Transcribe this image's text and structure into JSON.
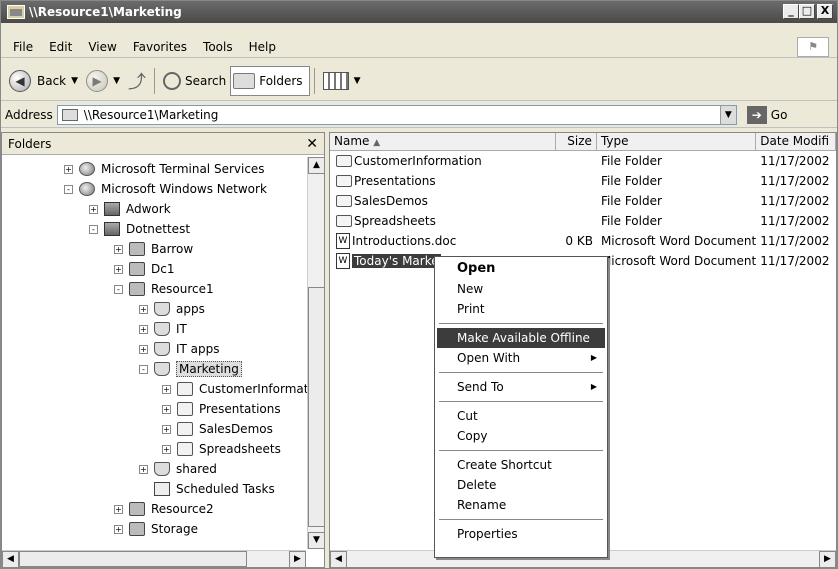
{
  "window": {
    "title": "\\\\Resource1\\Marketing",
    "minimize": "_",
    "maximize": "□",
    "close": "X"
  },
  "menu": [
    "File",
    "Edit",
    "View",
    "Favorites",
    "Tools",
    "Help"
  ],
  "toolbar": {
    "back_label": "Back",
    "search_label": "Search",
    "folders_label": "Folders"
  },
  "address": {
    "label": "Address",
    "value": "\\\\Resource1\\Marketing",
    "go_label": "Go"
  },
  "folders_pane": {
    "title": "Folders",
    "close": "✕"
  },
  "tree": [
    {
      "label": "Microsoft Terminal Services",
      "icon": "globe-icon",
      "expander": "+"
    },
    {
      "label": "Microsoft Windows Network",
      "icon": "globe-icon",
      "expander": "-"
    },
    {
      "label": "Adwork",
      "icon": "network-icon",
      "expander": "+"
    },
    {
      "label": "Dotnettest",
      "icon": "network-icon",
      "expander": "-"
    },
    {
      "label": "Barrow",
      "icon": "computer-icon",
      "expander": "+"
    },
    {
      "label": "Dc1",
      "icon": "computer-icon",
      "expander": "+"
    },
    {
      "label": "Resource1",
      "icon": "computer-icon",
      "expander": "-"
    },
    {
      "label": "apps",
      "icon": "share-icon",
      "expander": "+"
    },
    {
      "label": "IT",
      "icon": "share-icon",
      "expander": "+"
    },
    {
      "label": "IT apps",
      "icon": "share-icon",
      "expander": "+"
    },
    {
      "label": "Marketing",
      "icon": "share-icon",
      "expander": "-"
    },
    {
      "label": "CustomerInformat",
      "icon": "folder-icon",
      "expander": "+"
    },
    {
      "label": "Presentations",
      "icon": "folder-icon",
      "expander": "+"
    },
    {
      "label": "SalesDemos",
      "icon": "folder-icon",
      "expander": "+"
    },
    {
      "label": "Spreadsheets",
      "icon": "folder-icon",
      "expander": "+"
    },
    {
      "label": "shared",
      "icon": "share-icon",
      "expander": "+"
    },
    {
      "label": "Scheduled Tasks",
      "icon": "tasks-icon",
      "expander": ""
    },
    {
      "label": "Resource2",
      "icon": "computer-icon",
      "expander": "+"
    },
    {
      "label": "Storage",
      "icon": "computer-icon",
      "expander": "+"
    }
  ],
  "list": {
    "columns": {
      "name": "Name",
      "size": "Size",
      "type": "Type",
      "date": "Date Modifi"
    },
    "rows": [
      {
        "name": "CustomerInformation",
        "size": "",
        "type": "File Folder",
        "date": "11/17/2002",
        "icon": "folder-icon"
      },
      {
        "name": "Presentations",
        "size": "",
        "type": "File Folder",
        "date": "11/17/2002",
        "icon": "folder-icon"
      },
      {
        "name": "SalesDemos",
        "size": "",
        "type": "File Folder",
        "date": "11/17/2002",
        "icon": "folder-icon"
      },
      {
        "name": "Spreadsheets",
        "size": "",
        "type": "File Folder",
        "date": "11/17/2002",
        "icon": "folder-icon"
      },
      {
        "name": "Introductions.doc",
        "size": "0 KB",
        "type": "Microsoft Word Document",
        "date": "11/17/2002",
        "icon": "word-doc-icon"
      },
      {
        "name": "Today's Marke",
        "size": "",
        "type": "Microsoft Word Document",
        "date": "11/17/2002",
        "icon": "word-doc-icon"
      }
    ]
  },
  "context_menu": {
    "open": "Open",
    "new": "New",
    "print": "Print",
    "make_offline": "Make Available Offline",
    "open_with": "Open With",
    "send_to": "Send To",
    "cut": "Cut",
    "copy": "Copy",
    "create_shortcut": "Create Shortcut",
    "delete": "Delete",
    "rename": "Rename",
    "properties": "Properties"
  }
}
